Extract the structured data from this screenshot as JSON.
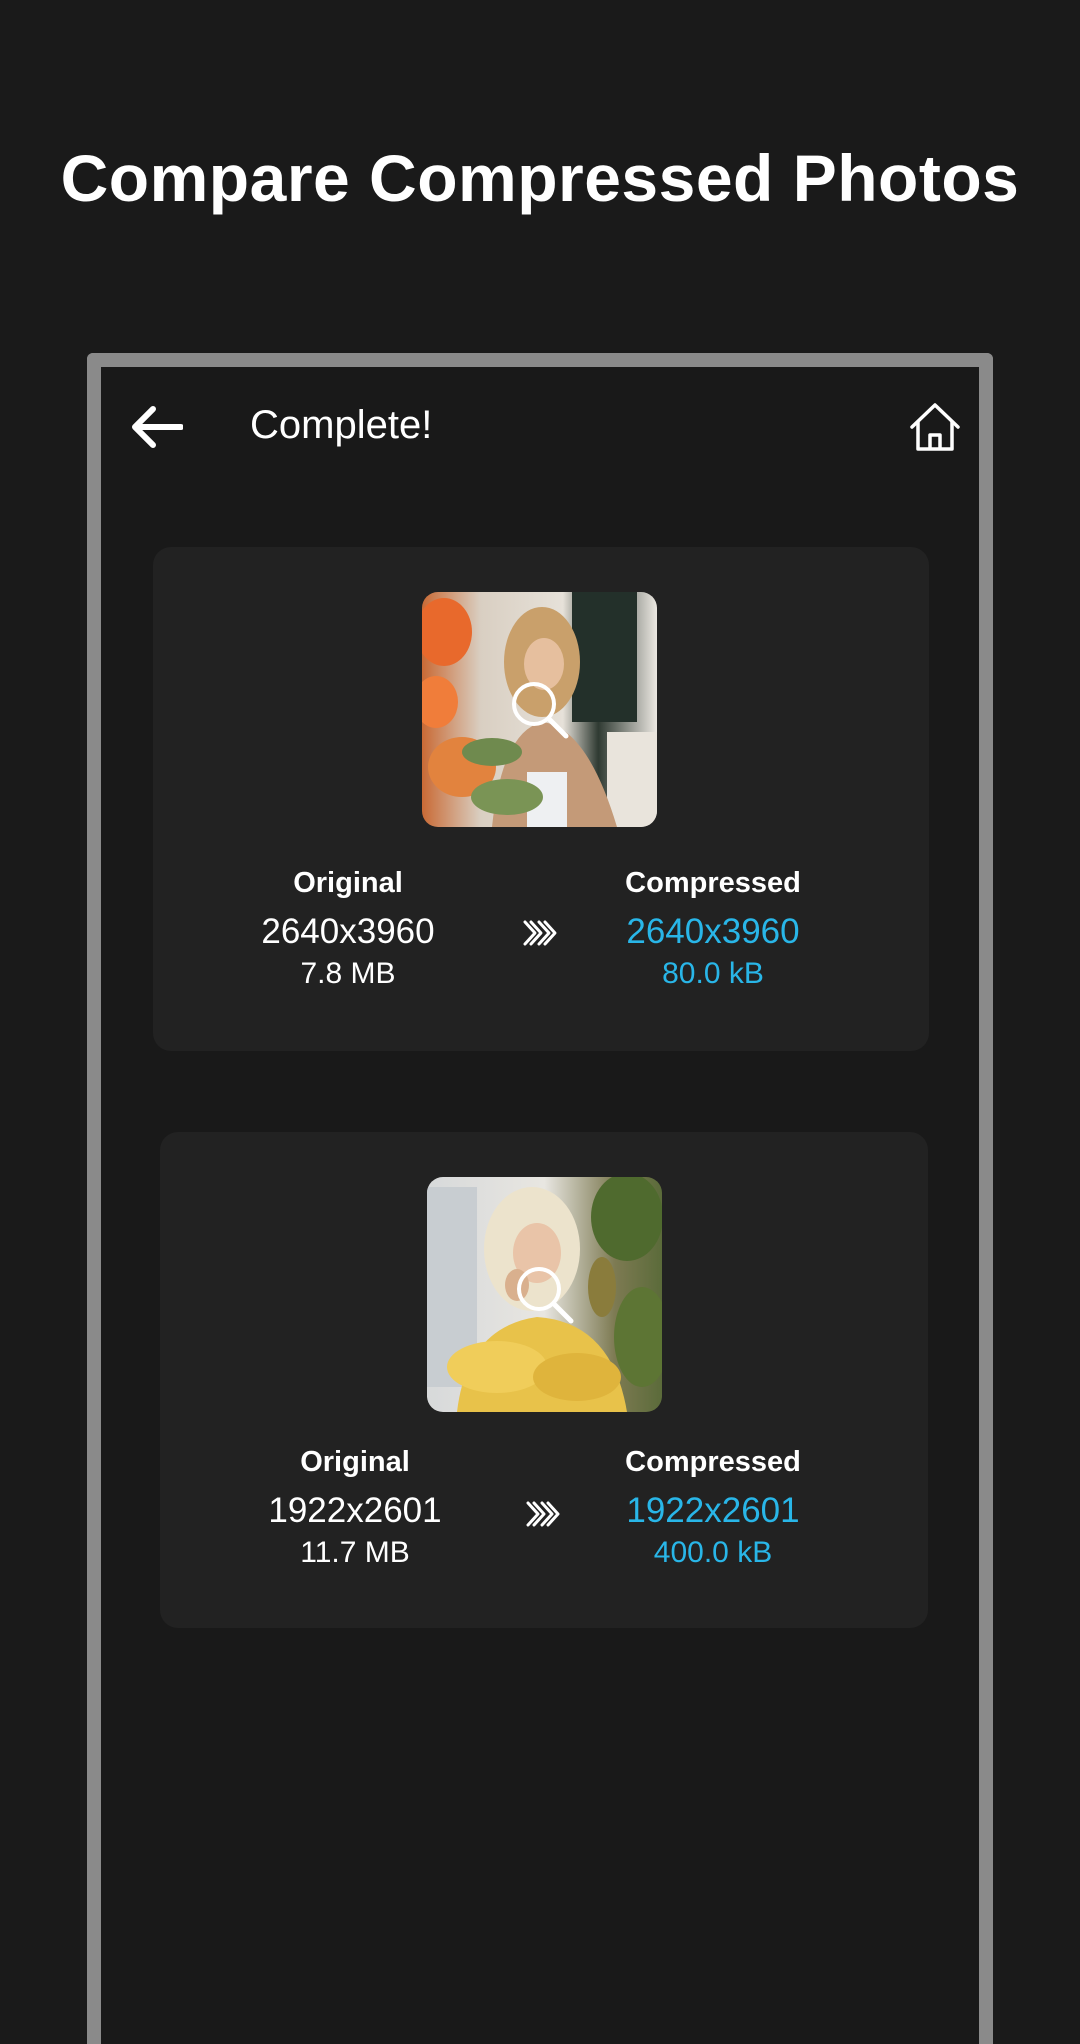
{
  "promo": {
    "title": "Compare Compressed Photos"
  },
  "app_bar": {
    "title": "Complete!",
    "back_icon": "arrow-left-icon",
    "home_icon": "home-icon"
  },
  "results": [
    {
      "original_label": "Original",
      "original_dims": "2640x3960",
      "original_size": "7.8 MB",
      "compressed_label": "Compressed",
      "compressed_dims": "2640x3960",
      "compressed_size": "80.0 kB"
    },
    {
      "original_label": "Original",
      "original_dims": "1922x2601",
      "original_size": "11.7 MB",
      "compressed_label": "Compressed",
      "compressed_dims": "1922x2601",
      "compressed_size": "400.0 kB"
    }
  ],
  "colors": {
    "background": "#1a1a1a",
    "card": "#222222",
    "frame": "#8a8a8a",
    "accent": "#29b6e8",
    "text": "#ffffff"
  }
}
